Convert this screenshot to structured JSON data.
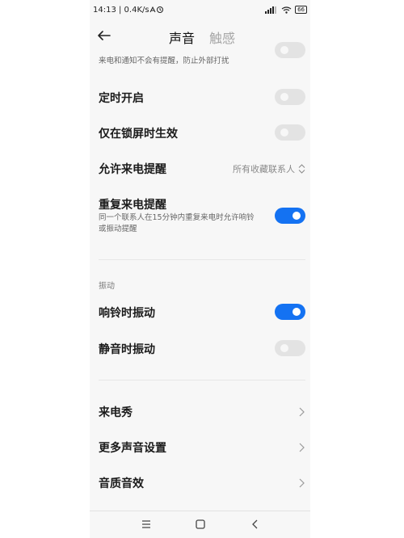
{
  "status_bar": {
    "left_text": "14:13 | 0.4K/s",
    "signal_icon": "signal-icon",
    "wifi_icon": "wifi-icon",
    "battery": "66"
  },
  "header": {
    "tab_sound": "声音",
    "tab_touch": "触感"
  },
  "settings": {
    "dnd_subtitle": "来电和通知不会有提醒，防止外部打扰",
    "scheduled": {
      "label": "定时开启",
      "on": false
    },
    "lockscreen_only": {
      "label": "仅在锁屏时生效",
      "on": false
    },
    "allow_calls": {
      "label": "允许来电提醒",
      "value": "所有收藏联系人"
    },
    "repeat_calls": {
      "label": "重复来电提醒",
      "subtitle_line1": "同一个联系人在15分钟内重复来电时允许响铃",
      "subtitle_line2": "或振动提醒",
      "on": true
    }
  },
  "vibration_section": {
    "header": "振动",
    "ring_vibrate": {
      "label": "响铃时振动",
      "on": true
    },
    "silent_vibrate": {
      "label": "静音时振动",
      "on": false
    }
  },
  "more_section": {
    "call_show": "来电秀",
    "more_sound_settings": "更多声音设置",
    "sound_quality": "音质音效"
  },
  "colors": {
    "accent": "#1472f2",
    "toggle_off": "#e3e3e3"
  }
}
